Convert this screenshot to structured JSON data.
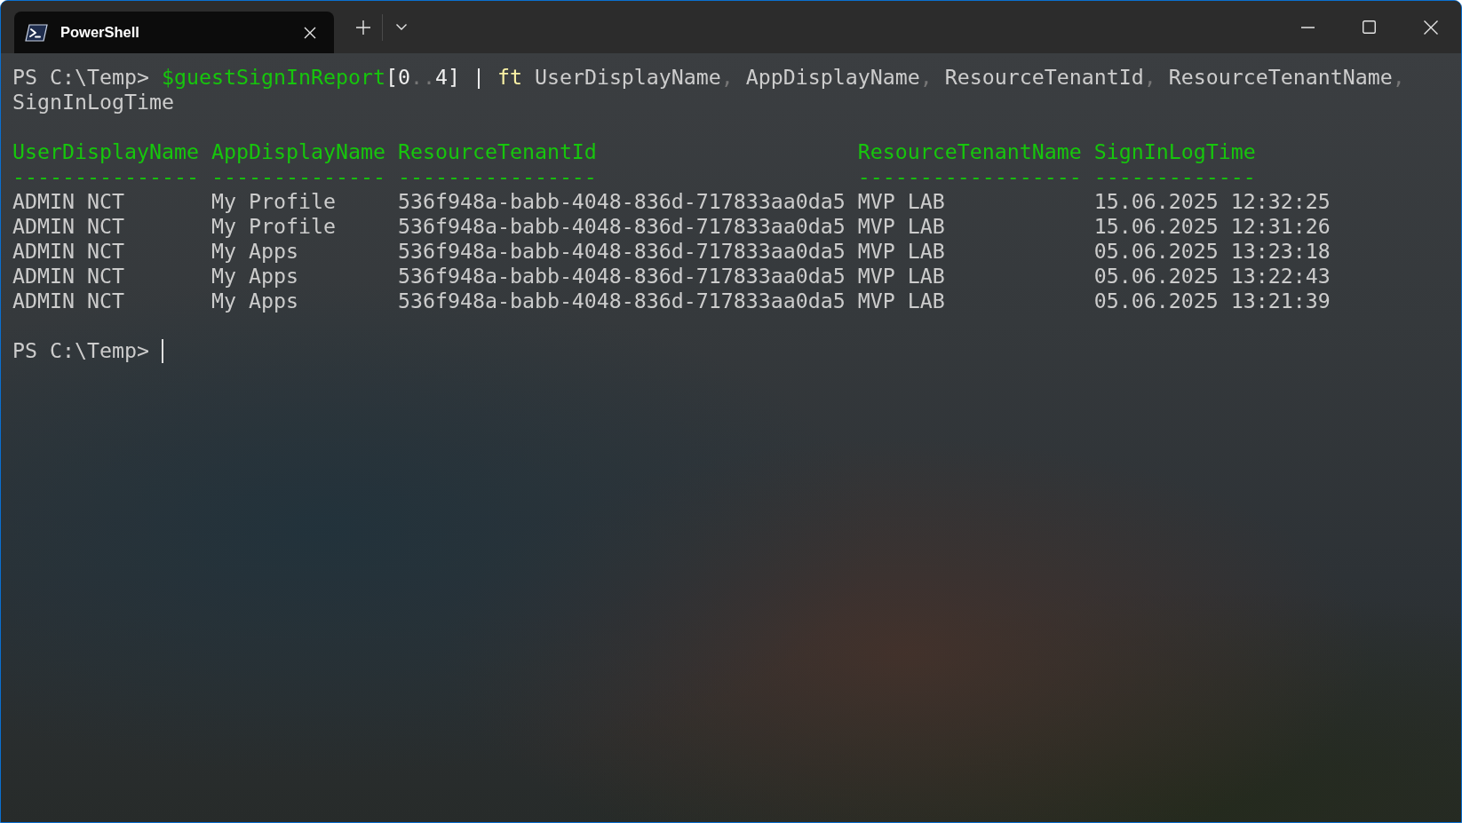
{
  "window": {
    "tabs": [
      {
        "title": "PowerShell",
        "selected": true
      }
    ]
  },
  "terminal": {
    "command": {
      "prompt": "PS C:\\Temp>",
      "lines": [
        {
          "words": [
            {
              "parts": [
                {
                  "text": "$guestSignInReport",
                  "kind": "variable"
                },
                {
                  "text": "[0",
                  "kind": "operator"
                },
                {
                  "text": "..",
                  "kind": "separator"
                },
                {
                  "text": "4]",
                  "kind": "operator"
                }
              ]
            },
            {
              "parts": [
                {
                  "text": "|",
                  "kind": "operator"
                }
              ]
            },
            {
              "parts": [
                {
                  "text": "ft",
                  "kind": "command"
                }
              ]
            },
            {
              "parts": [
                {
                  "text": "UserDisplayName",
                  "kind": "plain"
                },
                {
                  "text": ",",
                  "kind": "separator"
                }
              ]
            },
            {
              "parts": [
                {
                  "text": "AppDisplayName",
                  "kind": "plain"
                },
                {
                  "text": ",",
                  "kind": "separator"
                }
              ]
            },
            {
              "parts": [
                {
                  "text": "ResourceTenantId",
                  "kind": "plain"
                },
                {
                  "text": ",",
                  "kind": "separator"
                }
              ]
            },
            {
              "parts": [
                {
                  "text": "ResourceTenantName",
                  "kind": "plain"
                },
                {
                  "text": ",",
                  "kind": "separator"
                }
              ]
            }
          ]
        },
        {
          "words": [
            {
              "parts": [
                {
                  "text": "SignInLogTime",
                  "kind": "plain"
                }
              ]
            }
          ]
        }
      ]
    },
    "output": {
      "columns": [
        {
          "header": "UserDisplayName",
          "underline": "---------------"
        },
        {
          "header": "AppDisplayName",
          "underline": "--------------"
        },
        {
          "header": "ResourceTenantId",
          "underline": "----------------"
        },
        {
          "header": "ResourceTenantName",
          "underline": "------------------"
        },
        {
          "header": "SignInLogTime",
          "underline": "-------------"
        }
      ],
      "rows": [
        [
          "ADMIN NCT",
          "My Profile",
          "536f948a-babb-4048-836d-717833aa0da5",
          "MVP LAB",
          "15.06.2025 12:32:25"
        ],
        [
          "ADMIN NCT",
          "My Profile",
          "536f948a-babb-4048-836d-717833aa0da5",
          "MVP LAB",
          "15.06.2025 12:31:26"
        ],
        [
          "ADMIN NCT",
          "My Apps",
          "536f948a-babb-4048-836d-717833aa0da5",
          "MVP LAB",
          "05.06.2025 13:23:18"
        ],
        [
          "ADMIN NCT",
          "My Apps",
          "536f948a-babb-4048-836d-717833aa0da5",
          "MVP LAB",
          "05.06.2025 13:22:43"
        ],
        [
          "ADMIN NCT",
          "My Apps",
          "536f948a-babb-4048-836d-717833aa0da5",
          "MVP LAB",
          "05.06.2025 13:21:39"
        ]
      ]
    },
    "prompt": {
      "text": "PS C:\\Temp>",
      "cursor": true
    }
  }
}
